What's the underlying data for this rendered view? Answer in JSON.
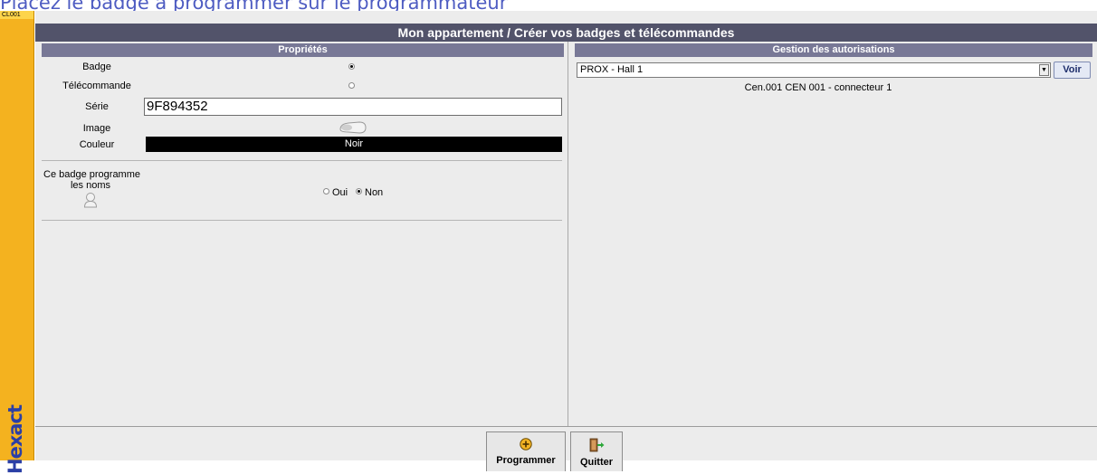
{
  "instruction": "Placez le badge à programmer sur le programmateur",
  "sidebar": {
    "code": "CL001",
    "logo": "Hexact"
  },
  "window": {
    "title": "Mon appartement / Créer vos badges et télécommandes"
  },
  "proprietes": {
    "header": "Propriétés",
    "badge_label": "Badge",
    "telecommande_label": "Télécommande",
    "type_selected": "Badge",
    "serie_label": "Série",
    "serie_value": "9F894352",
    "image_label": "Image",
    "image_icon": "badge-fob-icon",
    "couleur_label": "Couleur",
    "couleur_value": "Noir",
    "noms_label_line1": "Ce badge programme",
    "noms_label_line2": "les noms",
    "noms_icon": "user-icon",
    "oui_label": "Oui",
    "non_label": "Non",
    "noms_selected": "Non"
  },
  "autorisations": {
    "header": "Gestion des autorisations",
    "select_value": "PROX - Hall 1",
    "voir_label": "Voir",
    "detail": "Cen.001 CEN 001 - connecteur 1"
  },
  "footer": {
    "programmer_label": "Programmer",
    "programmer_icon": "plus-circle-icon",
    "quitter_label": "Quitter",
    "quitter_icon": "exit-door-icon"
  },
  "colors": {
    "title_bg": "#52536a",
    "header_bg": "#787896",
    "sidebar": "#f4b21f",
    "instruction_text": "#4e5cc2"
  }
}
